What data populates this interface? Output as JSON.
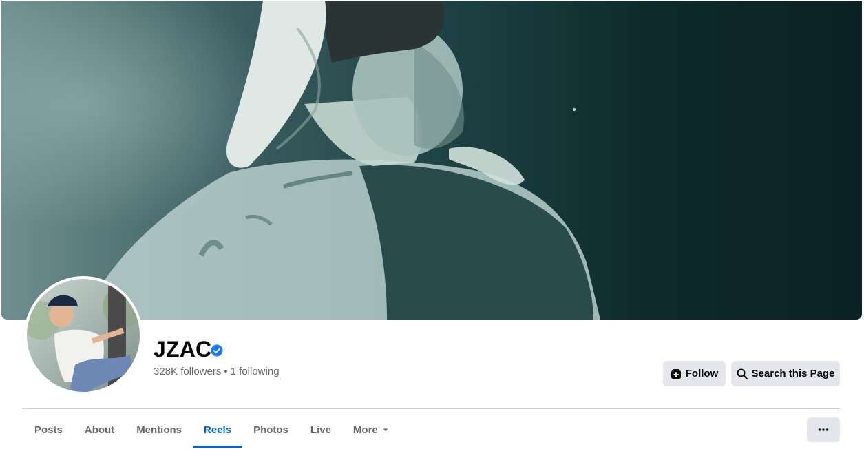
{
  "profile": {
    "name": "JZAC",
    "followers": "328K followers",
    "separator": "•",
    "following": "1 following"
  },
  "actions": {
    "follow_label": "Follow",
    "search_label": "Search this Page"
  },
  "tabs": [
    {
      "label": "Posts"
    },
    {
      "label": "About"
    },
    {
      "label": "Mentions"
    },
    {
      "label": "Reels",
      "active": true
    },
    {
      "label": "Photos"
    },
    {
      "label": "Live"
    },
    {
      "label": "More"
    }
  ],
  "colors": {
    "accent": "#0064d1",
    "verified": "#1877f2",
    "button_bg": "#e4e6eb",
    "secondary_text": "#65676b"
  },
  "icons": {
    "verified": "verified-badge-icon",
    "follow": "follow-icon",
    "search": "search-icon",
    "more_caret": "caret-down-icon",
    "overflow": "ellipsis-icon"
  }
}
